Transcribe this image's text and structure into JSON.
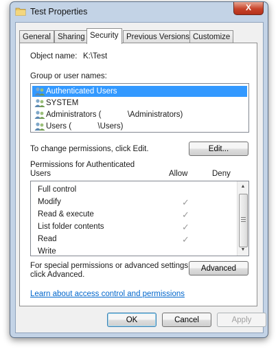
{
  "window": {
    "title": "Test Properties",
    "close_glyph": "X"
  },
  "tabs": [
    {
      "label": "General"
    },
    {
      "label": "Sharing"
    },
    {
      "label": "Security"
    },
    {
      "label": "Previous Versions"
    },
    {
      "label": "Customize"
    }
  ],
  "active_tab": "Security",
  "object": {
    "label": "Object name:",
    "value": "K:\\Test"
  },
  "groups": {
    "label": "Group or user names:",
    "items": [
      {
        "label": "Authenticated Users"
      },
      {
        "label": "SYSTEM"
      },
      {
        "label": "Administrators (            \\Administrators)"
      },
      {
        "label": "Users (            \\Users)"
      }
    ]
  },
  "change_hint": "To change permissions, click Edit.",
  "edit_button": "Edit...",
  "permissions": {
    "label_line1": "Permissions for Authenticated",
    "label_line2": "Users",
    "allow_header": "Allow",
    "deny_header": "Deny",
    "check_glyph": "✓",
    "rows": [
      {
        "name": "Full control",
        "allow": false
      },
      {
        "name": "Modify",
        "allow": true
      },
      {
        "name": "Read & execute",
        "allow": true
      },
      {
        "name": "List folder contents",
        "allow": true
      },
      {
        "name": "Read",
        "allow": true
      },
      {
        "name": "Write",
        "allow": true
      }
    ]
  },
  "special": {
    "line1": "For special permissions or advanced settings,",
    "line2": "click Advanced.",
    "button": "Advanced"
  },
  "learn_link": "Learn about access control and permissions",
  "footer": {
    "ok": "OK",
    "cancel": "Cancel",
    "apply": "Apply"
  },
  "colors": {
    "selection": "#3399ff",
    "link": "#0066cc",
    "frame": "#c3d3e6"
  }
}
